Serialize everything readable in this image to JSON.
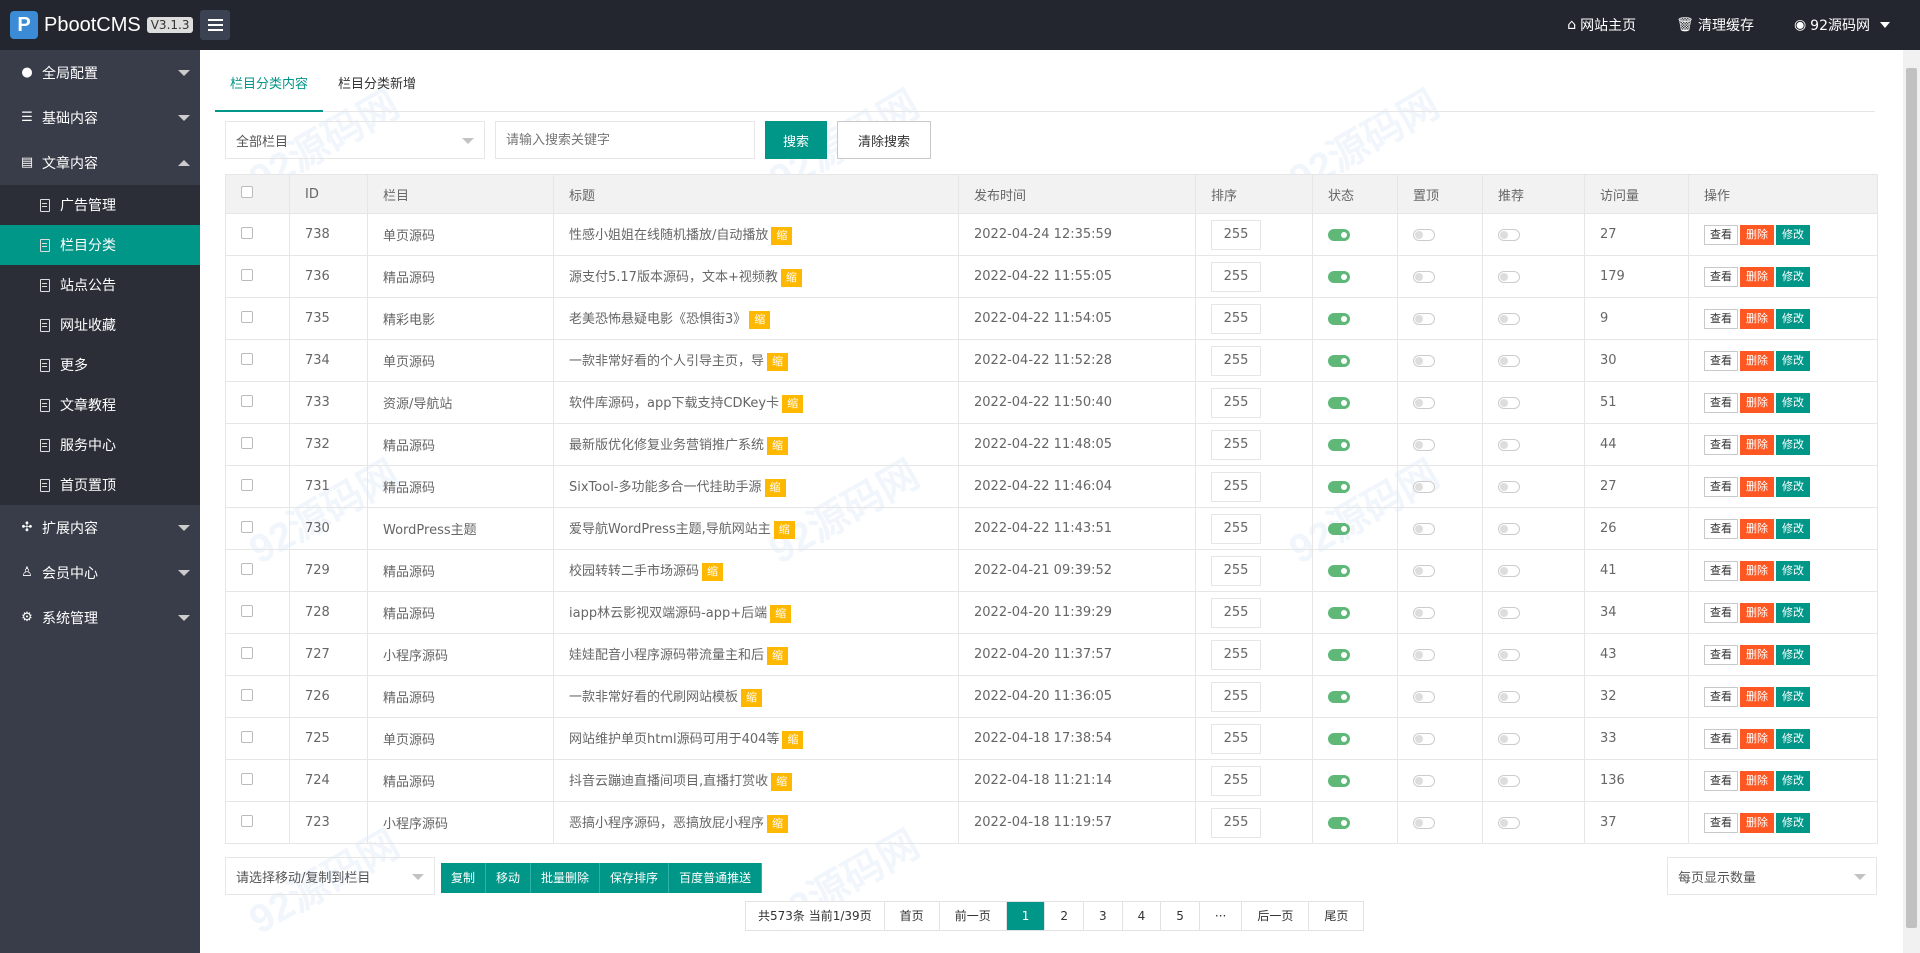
{
  "header": {
    "logo_text": "PbootCMS",
    "version": "V3.1.3",
    "site_home": "网站主页",
    "clear_cache": "清理缓存",
    "user": "92源码网"
  },
  "sidebar": {
    "groups": [
      {
        "label": "全局配置"
      },
      {
        "label": "基础内容"
      },
      {
        "label": "文章内容"
      },
      {
        "label": "扩展内容"
      },
      {
        "label": "会员中心"
      },
      {
        "label": "系统管理"
      }
    ],
    "sub_items": [
      {
        "label": "广告管理"
      },
      {
        "label": "栏目分类"
      },
      {
        "label": "站点公告"
      },
      {
        "label": "网址收藏"
      },
      {
        "label": "更多"
      },
      {
        "label": "文章教程"
      },
      {
        "label": "服务中心"
      },
      {
        "label": "首页置顶"
      }
    ]
  },
  "tabs": [
    {
      "label": "栏目分类内容"
    },
    {
      "label": "栏目分类新增"
    }
  ],
  "search": {
    "category_select": "全部栏目",
    "keyword_placeholder": "请输入搜索关键字",
    "search_button": "搜索",
    "clear_button": "清除搜索"
  },
  "table": {
    "headers": [
      "ID",
      "栏目",
      "标题",
      "发布时间",
      "排序",
      "状态",
      "置顶",
      "推荐",
      "访问量",
      "操作"
    ],
    "tag_label": "缩",
    "action_view": "查看",
    "action_delete": "删除",
    "action_edit": "修改",
    "rows": [
      {
        "id": "738",
        "category": "单页源码",
        "title": "性感小姐姐在线随机播放/自动播放",
        "date": "2022-04-24 12:35:59",
        "sort": "255",
        "views": "27"
      },
      {
        "id": "736",
        "category": "精品源码",
        "title": "源支付5.17版本源码，文本+视频教",
        "date": "2022-04-22 11:55:05",
        "sort": "255",
        "views": "179"
      },
      {
        "id": "735",
        "category": "精彩电影",
        "title": "老美恐怖悬疑电影《恐惧街3》",
        "date": "2022-04-22 11:54:05",
        "sort": "255",
        "views": "9"
      },
      {
        "id": "734",
        "category": "单页源码",
        "title": "一款非常好看的个人引导主页，导",
        "date": "2022-04-22 11:52:28",
        "sort": "255",
        "views": "30"
      },
      {
        "id": "733",
        "category": "资源/导航站",
        "title": "软件库源码，app下载支持CDKey卡",
        "date": "2022-04-22 11:50:40",
        "sort": "255",
        "views": "51"
      },
      {
        "id": "732",
        "category": "精品源码",
        "title": "最新版优化修复业务营销推广系统",
        "date": "2022-04-22 11:48:05",
        "sort": "255",
        "views": "44"
      },
      {
        "id": "731",
        "category": "精品源码",
        "title": "SixTool-多功能多合一代挂助手源",
        "date": "2022-04-22 11:46:04",
        "sort": "255",
        "views": "27"
      },
      {
        "id": "730",
        "category": "WordPress主题",
        "title": "爱导航WordPress主题,导航网站主",
        "date": "2022-04-22 11:43:51",
        "sort": "255",
        "views": "26"
      },
      {
        "id": "729",
        "category": "精品源码",
        "title": "校园转转二手市场源码",
        "date": "2022-04-21 09:39:52",
        "sort": "255",
        "views": "41"
      },
      {
        "id": "728",
        "category": "精品源码",
        "title": "iapp林云影视双端源码-app+后端",
        "date": "2022-04-20 11:39:29",
        "sort": "255",
        "views": "34"
      },
      {
        "id": "727",
        "category": "小程序源码",
        "title": "娃娃配音小程序源码带流量主和后",
        "date": "2022-04-20 11:37:57",
        "sort": "255",
        "views": "43"
      },
      {
        "id": "726",
        "category": "精品源码",
        "title": "一款非常好看的代刷网站模板",
        "date": "2022-04-20 11:36:05",
        "sort": "255",
        "views": "32"
      },
      {
        "id": "725",
        "category": "单页源码",
        "title": "网站维护单页html源码可用于404等",
        "date": "2022-04-18 17:38:54",
        "sort": "255",
        "views": "33"
      },
      {
        "id": "724",
        "category": "精品源码",
        "title": "抖音云蹦迪直播间项目,直播打赏收",
        "date": "2022-04-18 11:21:14",
        "sort": "255",
        "views": "136"
      },
      {
        "id": "723",
        "category": "小程序源码",
        "title": "恶搞小程序源码，恶搞放屁小程序",
        "date": "2022-04-18 11:19:57",
        "sort": "255",
        "views": "37"
      }
    ]
  },
  "bulk": {
    "move_select": "请选择移动/复制到栏目",
    "buttons": [
      "复制",
      "移动",
      "批量删除",
      "保存排序",
      "百度普通推送"
    ],
    "per_page": "每页显示数量"
  },
  "pager": {
    "info": "共573条 当前1/39页",
    "first": "首页",
    "prev": "前一页",
    "pages": [
      "1",
      "2",
      "3",
      "4",
      "5",
      "···"
    ],
    "next": "后一页",
    "last": "尾页"
  },
  "watermark": "92源码网 www.92luntan.com",
  "colors": {
    "accent": "#009688",
    "danger": "#ff5722",
    "warning": "#ffb800",
    "header_bg": "#23262e",
    "sidebar_bg": "#393d49"
  }
}
